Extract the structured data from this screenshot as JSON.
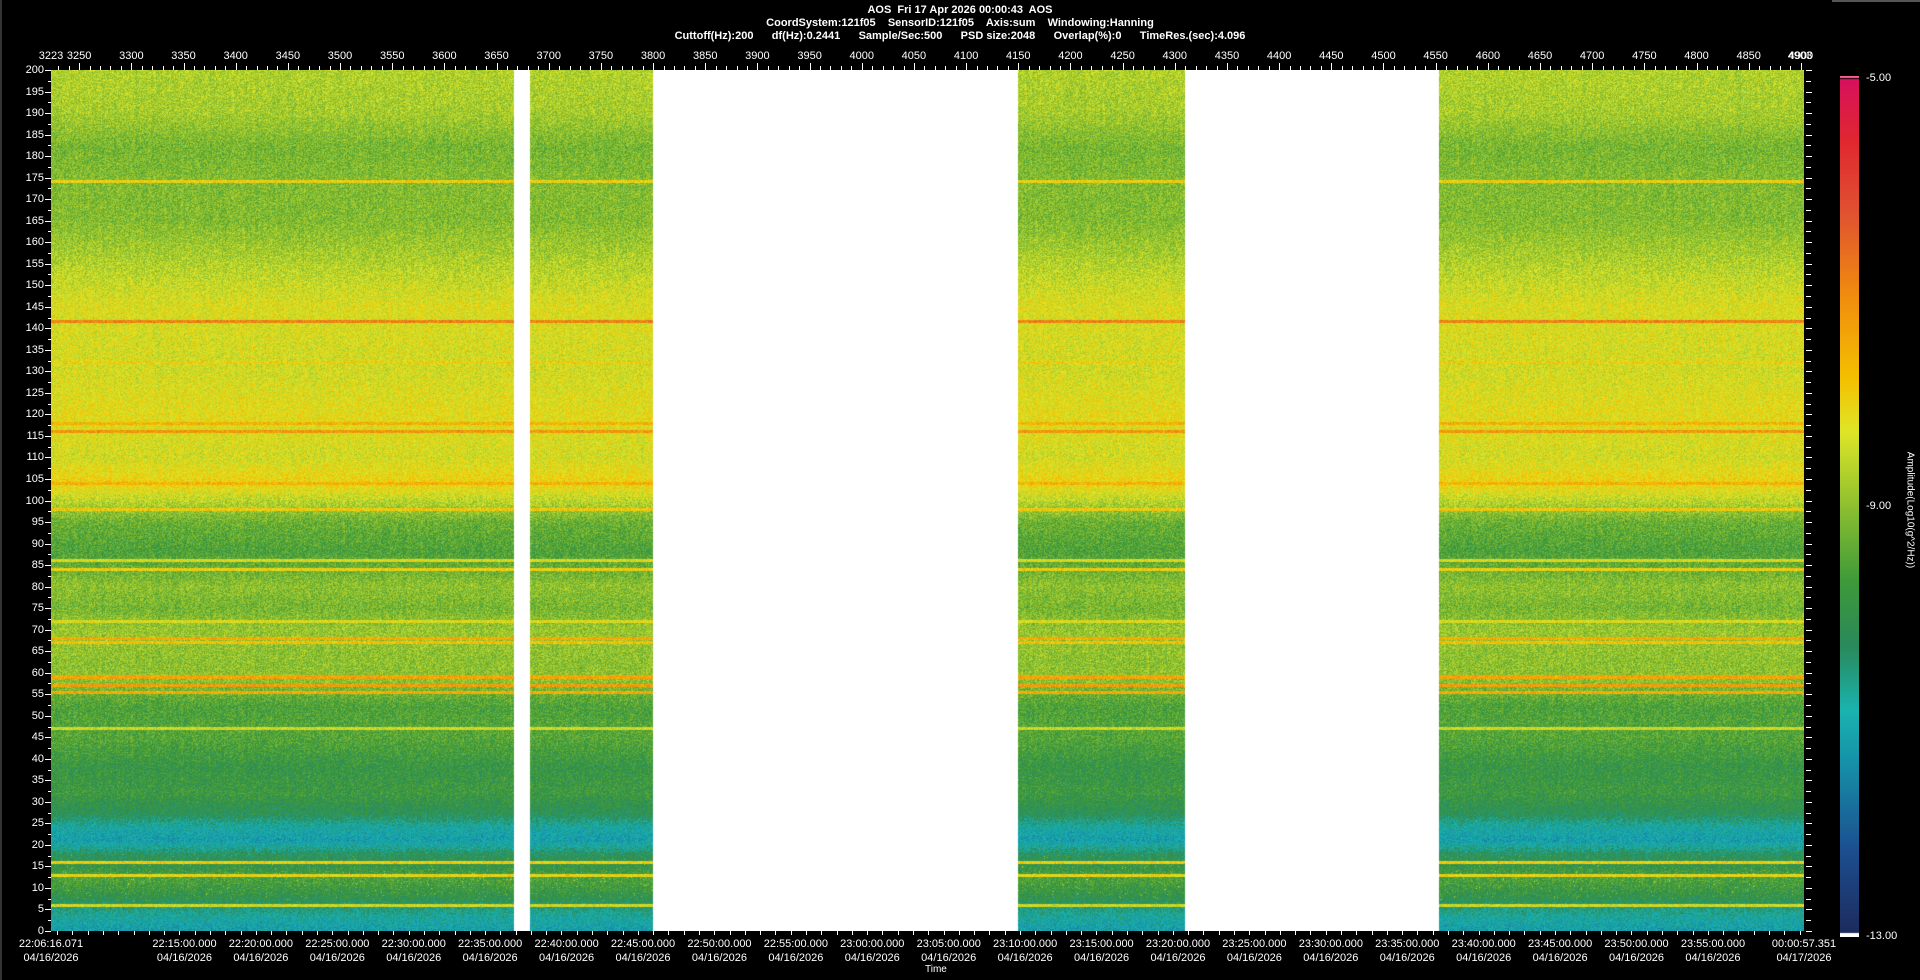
{
  "header": {
    "line1": "AOS  Fri 17 Apr 2026 00:00:43  AOS",
    "line2": "CoordSystem:121f05    SensorID:121f05    Axis:sum    Windowing:Hanning",
    "line3": "Cuttoff(Hz):200      df(Hz):0.2441      Sample/Sec:500      PSD size:2048      Overlap(%):0      TimeRes.(sec):4.096"
  },
  "chart_data": {
    "type": "heatmap",
    "title": "AOS  Fri 17 Apr 2026 00:00:43  AOS",
    "xlabel": "Time",
    "colorbar_label": "Amplitude(Log10(g^2/Hz))",
    "top_axis": {
      "range": [
        3223,
        4903
      ],
      "end_labels": [
        "3223",
        "4903"
      ],
      "labels": [
        "3250",
        "3300",
        "3350",
        "3400",
        "3450",
        "3500",
        "3550",
        "3600",
        "3650",
        "3700",
        "3750",
        "3800",
        "3850",
        "3900",
        "3950",
        "4000",
        "4050",
        "4100",
        "4150",
        "4200",
        "4250",
        "4300",
        "4350",
        "4400",
        "4450",
        "4500",
        "4550",
        "4600",
        "4650",
        "4700",
        "4750",
        "4800",
        "4850",
        "4900"
      ]
    },
    "y_axis": {
      "range": [
        0,
        200
      ],
      "labels": [
        "0",
        "5",
        "10",
        "15",
        "20",
        "25",
        "30",
        "35",
        "40",
        "45",
        "50",
        "55",
        "60",
        "65",
        "70",
        "75",
        "80",
        "85",
        "90",
        "95",
        "100",
        "105",
        "110",
        "115",
        "120",
        "125",
        "130",
        "135",
        "140",
        "145",
        "150",
        "155",
        "160",
        "165",
        "170",
        "175",
        "180",
        "185",
        "190",
        "195",
        "200"
      ]
    },
    "time_axis": {
      "start_seconds": 0,
      "end_seconds": 6881.28,
      "labels": [
        {
          "t": 0,
          "time": "22:06:16.071",
          "date": "04/16/2026"
        },
        {
          "t": 523.929,
          "time": "22:15:00.000",
          "date": "04/16/2026"
        },
        {
          "t": 823.929,
          "time": "22:20:00.000",
          "date": "04/16/2026"
        },
        {
          "t": 1123.929,
          "time": "22:25:00.000",
          "date": "04/16/2026"
        },
        {
          "t": 1423.929,
          "time": "22:30:00.000",
          "date": "04/16/2026"
        },
        {
          "t": 1723.929,
          "time": "22:35:00.000",
          "date": "04/16/2026"
        },
        {
          "t": 2023.929,
          "time": "22:40:00.000",
          "date": "04/16/2026"
        },
        {
          "t": 2323.929,
          "time": "22:45:00.000",
          "date": "04/16/2026"
        },
        {
          "t": 2623.929,
          "time": "22:50:00.000",
          "date": "04/16/2026"
        },
        {
          "t": 2923.929,
          "time": "22:55:00.000",
          "date": "04/16/2026"
        },
        {
          "t": 3223.929,
          "time": "23:00:00.000",
          "date": "04/16/2026"
        },
        {
          "t": 3523.929,
          "time": "23:05:00.000",
          "date": "04/16/2026"
        },
        {
          "t": 3823.929,
          "time": "23:10:00.000",
          "date": "04/16/2026"
        },
        {
          "t": 4123.929,
          "time": "23:15:00.000",
          "date": "04/16/2026"
        },
        {
          "t": 4423.929,
          "time": "23:20:00.000",
          "date": "04/16/2026"
        },
        {
          "t": 4723.929,
          "time": "23:25:00.000",
          "date": "04/16/2026"
        },
        {
          "t": 5023.929,
          "time": "23:30:00.000",
          "date": "04/16/2026"
        },
        {
          "t": 5323.929,
          "time": "23:35:00.000",
          "date": "04/16/2026"
        },
        {
          "t": 5623.929,
          "time": "23:40:00.000",
          "date": "04/16/2026"
        },
        {
          "t": 5923.929,
          "time": "23:45:00.000",
          "date": "04/16/2026"
        },
        {
          "t": 6223.929,
          "time": "23:50:00.000",
          "date": "04/16/2026"
        },
        {
          "t": 6523.929,
          "time": "23:55:00.000",
          "date": "04/16/2026"
        },
        {
          "t": 6881.28,
          "time": "00:00:57.351",
          "date": "04/17/2026"
        }
      ]
    },
    "data_segments": [
      [
        3223,
        3667
      ],
      [
        3682,
        3800
      ],
      [
        4150,
        4310
      ],
      [
        4553,
        4903
      ]
    ],
    "colorbar": {
      "min": -13.0,
      "max": -5.0,
      "labels": [
        "-5.00",
        "-9.00",
        "-13.00"
      ]
    },
    "colormap": [
      [
        -13.0,
        "#1e2a5c"
      ],
      [
        -12.2,
        "#1c4f90"
      ],
      [
        -11.4,
        "#1690a8"
      ],
      [
        -10.9,
        "#1ab4b0"
      ],
      [
        -10.3,
        "#2a8a5c"
      ],
      [
        -9.7,
        "#3e9a3a"
      ],
      [
        -9.0,
        "#8ec030"
      ],
      [
        -8.3,
        "#e0e628"
      ],
      [
        -7.8,
        "#f4c000"
      ],
      [
        -7.0,
        "#f08a10"
      ],
      [
        -6.3,
        "#e05530"
      ],
      [
        -5.6,
        "#e02830"
      ],
      [
        -5.0,
        "#d81060"
      ]
    ],
    "frequency_profile": [
      [
        0,
        -11.2
      ],
      [
        3,
        -10.9
      ],
      [
        8,
        -10.0
      ],
      [
        12,
        -9.6
      ],
      [
        18,
        -10.3
      ],
      [
        21,
        -11.2
      ],
      [
        24,
        -10.9
      ],
      [
        27,
        -10.2
      ],
      [
        32,
        -9.8
      ],
      [
        38,
        -9.9
      ],
      [
        45,
        -9.5
      ],
      [
        52,
        -9.6
      ],
      [
        58,
        -9.0
      ],
      [
        63,
        -9.0
      ],
      [
        70,
        -8.9
      ],
      [
        75,
        -9.2
      ],
      [
        80,
        -9.0
      ],
      [
        88,
        -9.6
      ],
      [
        95,
        -9.3
      ],
      [
        100,
        -8.6
      ],
      [
        104,
        -8.0
      ],
      [
        110,
        -8.4
      ],
      [
        120,
        -8.2
      ],
      [
        130,
        -8.4
      ],
      [
        145,
        -8.3
      ],
      [
        155,
        -8.7
      ],
      [
        165,
        -9.1
      ],
      [
        175,
        -9.1
      ],
      [
        182,
        -9.2
      ],
      [
        190,
        -8.8
      ],
      [
        200,
        -8.7
      ]
    ],
    "spectral_lines": [
      [
        174,
        -8.0
      ],
      [
        141.5,
        -6.9
      ],
      [
        132,
        -8.0
      ],
      [
        118,
        -7.6
      ],
      [
        116,
        -7.2
      ],
      [
        104,
        -7.6
      ],
      [
        98,
        -7.9
      ],
      [
        86,
        -8.3
      ],
      [
        84,
        -8.0
      ],
      [
        72,
        -8.3
      ],
      [
        68,
        -7.5
      ],
      [
        67,
        -7.8
      ],
      [
        59,
        -7.4
      ],
      [
        57,
        -7.3
      ],
      [
        55.5,
        -7.5
      ],
      [
        47,
        -8.4
      ],
      [
        16,
        -8.0
      ],
      [
        13,
        -8.1
      ],
      [
        6,
        -8.4
      ]
    ]
  }
}
